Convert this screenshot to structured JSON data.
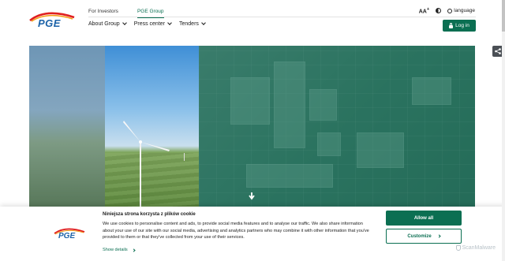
{
  "brand": {
    "logo_text": "PGE",
    "accent": "#0b6f52",
    "logo_blue": "#1d63a8"
  },
  "top_nav": {
    "investors": "For Investors",
    "group": "PGE Group"
  },
  "main_nav": [
    {
      "label": "About Group"
    },
    {
      "label": "Press center"
    },
    {
      "label": "Tenders"
    }
  ],
  "tools": {
    "font_size": "AA",
    "language": "language"
  },
  "login": {
    "label": "Log in"
  },
  "cookie": {
    "title": "Niniejsza strona korzysta z plików cookie",
    "body": "We use cookies to personalise content and ads, to provide social media features and to analyse our traffic. We also share information about your use of our site with our social media, advertising and analytics partners who may combine it with other information that you've provided to them or that they've collected from your use of their services.",
    "details": "Show details",
    "allow_all": "Allow all",
    "customize": "Customize",
    "watermark": "ScanMalware"
  }
}
